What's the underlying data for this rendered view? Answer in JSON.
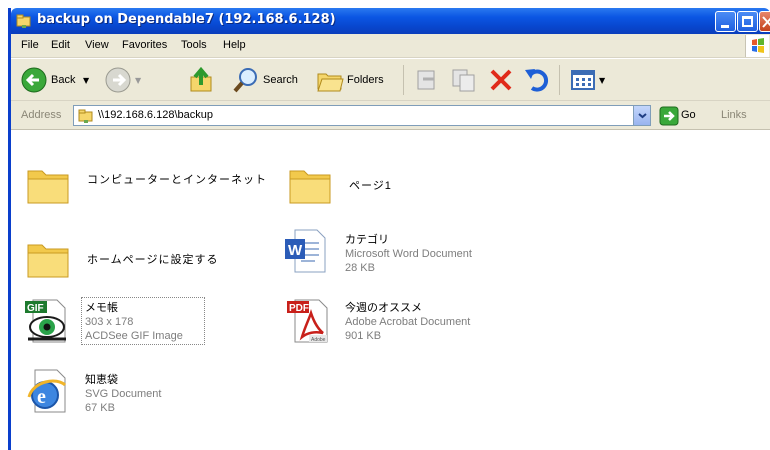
{
  "window": {
    "title": "backup on Dependable7 (192.168.6.128)"
  },
  "menu": {
    "items": [
      "File",
      "Edit",
      "View",
      "Favorites",
      "Tools",
      "Help"
    ]
  },
  "toolbar": {
    "back_label": "Back",
    "search_label": "Search",
    "folders_label": "Folders"
  },
  "address": {
    "label": "Address",
    "value": "\\\\192.168.6.128\\backup",
    "go_label": "Go",
    "links_label": "Links"
  },
  "files": [
    {
      "name": "コンピューターとインターネット",
      "type": "folder"
    },
    {
      "name": "ページ1",
      "type": "folder"
    },
    {
      "name": "ホームページに設定する",
      "type": "folder"
    },
    {
      "name": "カテゴリ",
      "type": "word",
      "kind": "Microsoft Word Document",
      "size": "28 KB"
    },
    {
      "name": "メモ帳",
      "type": "gif",
      "dims": "303 x 178",
      "kind": "ACDSee GIF Image"
    },
    {
      "name": "今週のオススメ",
      "type": "pdf",
      "kind": "Adobe Acrobat Document",
      "size": "901 KB"
    },
    {
      "name": "知恵袋",
      "type": "svg",
      "kind": "SVG Document",
      "size": "67 KB"
    }
  ],
  "icons": {
    "title": "network-folder-icon",
    "back": "back-arrow-icon",
    "forward": "forward-arrow-icon",
    "up": "up-folder-icon",
    "search": "search-icon",
    "folders": "folders-icon",
    "move": "move-to-icon",
    "copy": "copy-to-icon",
    "delete": "delete-icon",
    "undo": "undo-icon",
    "views": "views-icon",
    "go": "go-arrow-icon"
  }
}
